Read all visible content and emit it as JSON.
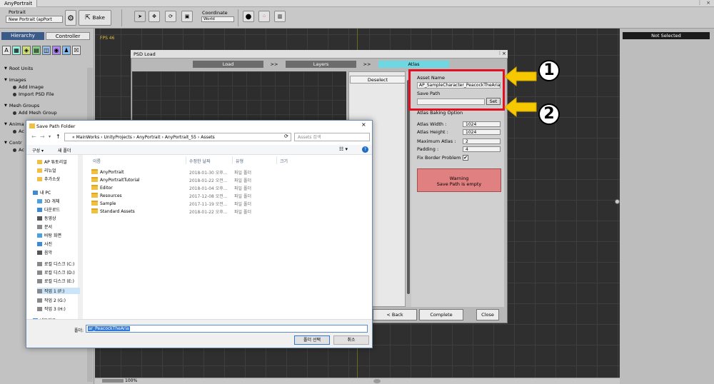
{
  "window": {
    "title": "AnyPortrait"
  },
  "toolbar": {
    "portrait_label": "Portrait",
    "portrait_value": "New Portrait (apPort",
    "bake_label": "Bake",
    "coordinate_label": "Coordinate",
    "coordinate_value": "World"
  },
  "left_panel": {
    "tab_hierarchy": "Hierarchy",
    "tab_controller": "Controller",
    "icons": [
      "A",
      "img",
      "sq",
      "layer",
      "grp",
      "anim",
      "rig",
      "x"
    ],
    "root_units": "Root Units",
    "images": "Images",
    "add_image": "Add Image",
    "import_psd": "Import PSD File",
    "mesh_groups": "Mesh Groups",
    "add_mesh_group": "Add Mesh Group",
    "animations": "Anima",
    "animations_sub": "Ac",
    "controllers": "Contr",
    "controllers_sub": "Ac"
  },
  "scene": {
    "fps": "FPS 46",
    "zoom": "100%"
  },
  "right_panel": {
    "not_selected": "Not Selected"
  },
  "psd_window": {
    "title": "PSD Load",
    "steps": [
      "Load",
      ">>",
      "Layers",
      ">>",
      "Atlas"
    ],
    "deselect": "Deselect",
    "asset_name_label": "Asset Name",
    "asset_name_value": "AP_SampleCharacter_PeacockTheAria",
    "save_path_label": "Save Path",
    "save_path_value": "",
    "set_button": "Set",
    "atlas_baking_option": "Atlas Baking Option",
    "atlas_width_label": "Atlas Width :",
    "atlas_width_value": "1024",
    "atlas_height_label": "Atlas Height :",
    "atlas_height_value": "1024",
    "max_atlas_label": "Maximum Atlas :",
    "max_atlas_value": "2",
    "padding_label": "Padding :",
    "padding_value": "4",
    "fix_border_label": "Fix Border Problem",
    "warning_title": "Warning",
    "warning_text": "Save Path is empty",
    "back_button": "< Back",
    "complete_button": "Complete",
    "close_button": "Close"
  },
  "callouts": [
    "1",
    "2"
  ],
  "save_dialog": {
    "title": "Save Path Folder",
    "breadcrumb": [
      "«",
      "MainWorks",
      "UnityProjects",
      "AnyPortrait",
      "AnyPortrait_55",
      "Assets"
    ],
    "search_placeholder": "Assets 검색",
    "organize": "구성 ▾",
    "new_folder": "새 폴더",
    "nav_items": [
      "AP 튜토리얼",
      "리뉴얼",
      "추가소샷",
      "내 PC",
      "3D 개체",
      "다운로드",
      "동영상",
      "문서",
      "바탕 화면",
      "사진",
      "음악",
      "로컬 디스크 (C:)",
      "로컬 디스크 (D:)",
      "로컬 디스크 (E:)",
      "작업 1 (F:)",
      "작업 2 (G:)",
      "작업 3 (H:)",
      "네트워크"
    ],
    "columns": [
      "이름",
      "수정한 날짜",
      "유형",
      "크기"
    ],
    "files": [
      {
        "name": "AnyPortrait",
        "date": "2018-01-30 오후...",
        "type": "파일 폴더"
      },
      {
        "name": "AnyPortraitTutorial",
        "date": "2018-01-22 오전...",
        "type": "파일 폴더"
      },
      {
        "name": "Editor",
        "date": "2018-01-04 오후...",
        "type": "파일 폴더"
      },
      {
        "name": "Resources",
        "date": "2017-12-08 오전...",
        "type": "파일 폴더"
      },
      {
        "name": "Sample",
        "date": "2017-11-19 오전...",
        "type": "파일 폴더"
      },
      {
        "name": "Standard Assets",
        "date": "2018-01-22 오후...",
        "type": "파일 폴더"
      }
    ],
    "folder_label": "폴더:",
    "folder_value": "ar_PeacockTheAria",
    "select_button": "폴더 선택",
    "cancel_button": "취소"
  },
  "colors": {
    "accent_cyan": "#6ed8e2",
    "highlight_red": "#e01020",
    "warning": "#e08080",
    "arrow_yellow": "#f5c800"
  }
}
